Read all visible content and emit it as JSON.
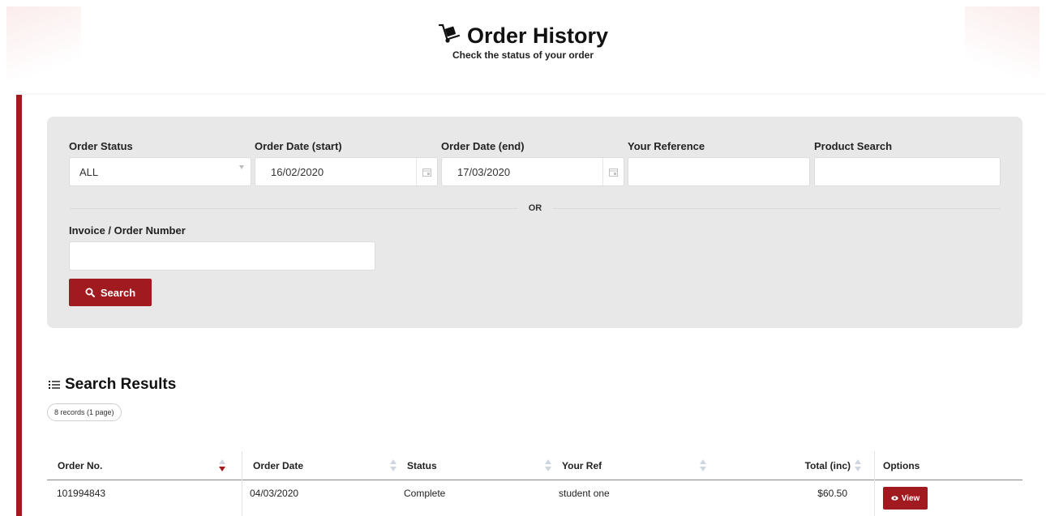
{
  "header": {
    "title": "Order History",
    "subtitle": "Check the status of your order"
  },
  "filters": {
    "order_status": {
      "label": "Order Status",
      "value": "ALL"
    },
    "date_start": {
      "label": "Order Date (start)",
      "value": "16/02/2020"
    },
    "date_end": {
      "label": "Order Date (end)",
      "value": "17/03/2020"
    },
    "your_reference": {
      "label": "Your Reference",
      "value": ""
    },
    "product_search": {
      "label": "Product Search",
      "value": ""
    },
    "or_text": "OR",
    "invoice_number": {
      "label": "Invoice / Order Number",
      "value": ""
    },
    "search_button": "Search"
  },
  "results": {
    "title": "Search Results",
    "records_badge": "8 records (1 page)",
    "columns": [
      "Order No.",
      "Order Date",
      "Status",
      "Your Ref",
      "Total (inc)",
      "Options"
    ],
    "rows": [
      {
        "order_no": "101994843",
        "order_date": "04/03/2020",
        "status": "Complete",
        "your_ref": "student one",
        "total": "$60.50",
        "action": "View"
      }
    ]
  },
  "colors": {
    "accent": "#a01a1f",
    "panel": "#e8e8e8"
  },
  "icons": [
    "hand-truck-icon",
    "calendar-icon",
    "search-icon",
    "list-icon",
    "eye-icon",
    "sort-icon"
  ]
}
